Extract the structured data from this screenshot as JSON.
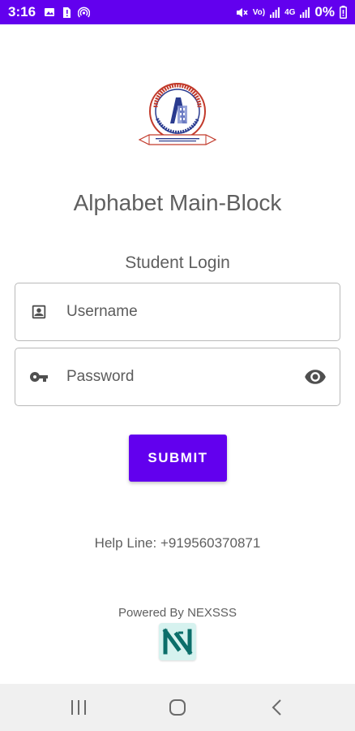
{
  "status_bar": {
    "time": "3:16",
    "network_labels": [
      "Vo)",
      "LTE1",
      "4G"
    ],
    "battery_text": "0%"
  },
  "app": {
    "title": "Alphabet Main-Block",
    "login_heading": "Student Login"
  },
  "logo": {
    "name": "alphabet-group-of-schools-emblem"
  },
  "form": {
    "username_placeholder": "Username",
    "password_placeholder": "Password",
    "submit_label": "SUBMIT"
  },
  "footer": {
    "helpline": "Help Line: +919560370871",
    "powered_by": "Powered By NEXSSS"
  },
  "colors": {
    "primary": "#6200ee",
    "text": "#5f5f5f",
    "border": "#b9b9b9",
    "brand_bg": "#d6f2ef",
    "brand_fg": "#0b6e6a"
  },
  "icons": [
    "gallery-icon",
    "sim-alert-icon",
    "hotspot-icon",
    "mute-icon",
    "signal-icon",
    "battery-icon",
    "account-box-icon",
    "key-icon",
    "eye-icon",
    "recents-icon",
    "home-icon",
    "back-icon"
  ]
}
